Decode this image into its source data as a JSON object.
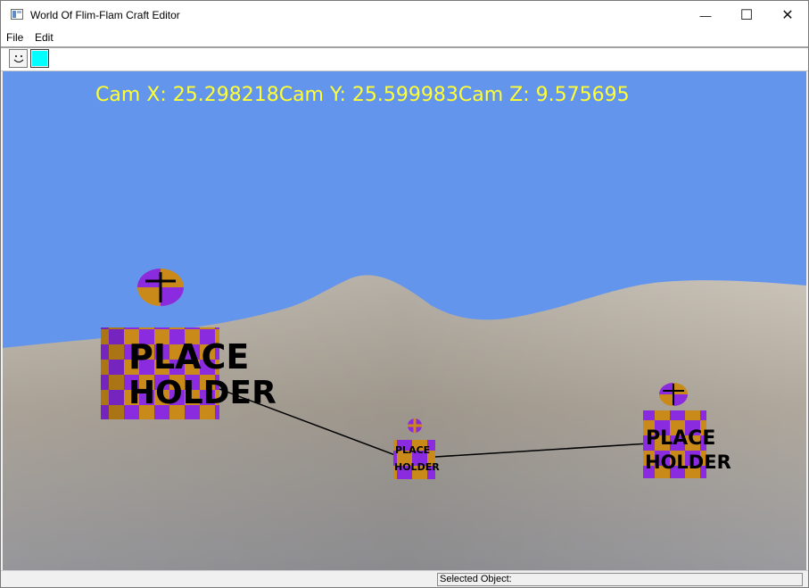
{
  "window": {
    "title": "World Of Flim-Flam Craft Editor",
    "minimize": "—",
    "maximize": "☐",
    "close": "✕"
  },
  "menu": {
    "items": [
      "File",
      "Edit"
    ]
  },
  "toolbar": {
    "buttons": [
      {
        "icon": "smiley-icon",
        "glyph": "⌣"
      },
      {
        "icon": "color-swatch-icon",
        "color": "#00ffff"
      }
    ]
  },
  "viewport": {
    "camera_readout": "Cam X: 25.298218Cam Y: 25.599983Cam Z: 9.575695",
    "sky_color": "#6495ed",
    "crate_label_line1": "PLACE",
    "crate_label_line2": "HOLDER"
  },
  "status": {
    "selected_object": "Selected Object:"
  }
}
